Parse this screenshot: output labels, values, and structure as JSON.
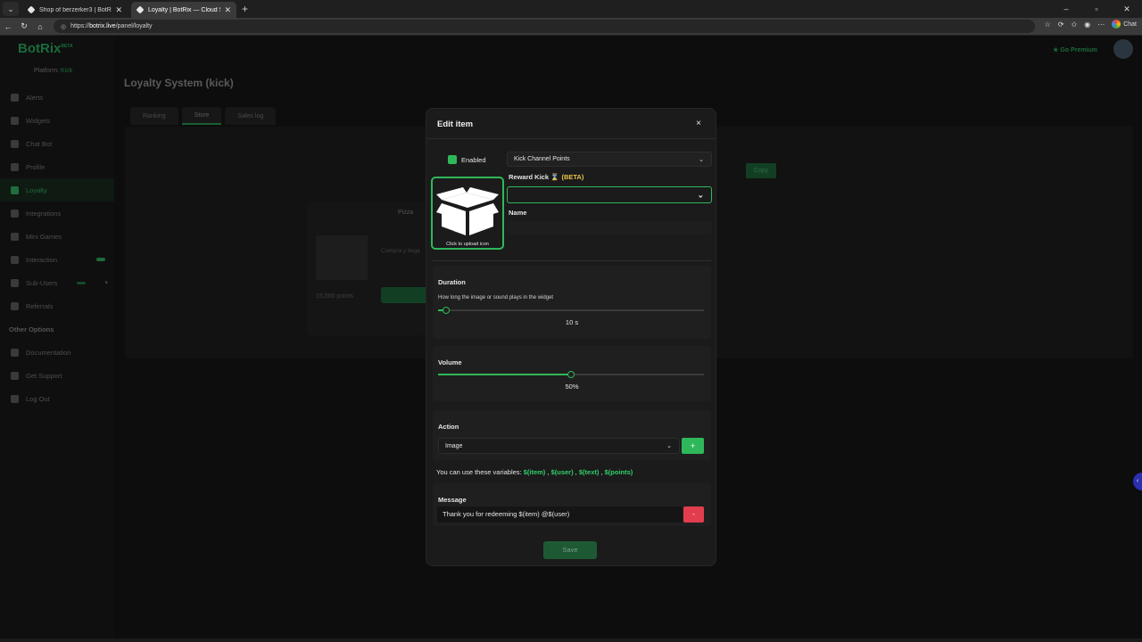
{
  "browser": {
    "tabs": [
      {
        "title": "Shop of berzerker3 | BotRix — Clo",
        "active": false
      },
      {
        "title": "Loyalty | BotRix — Cloud Streamin",
        "active": true
      }
    ],
    "url_prefix": "https://",
    "url_host": "botrix.live",
    "url_path": "/panel/loyalty",
    "chat_label": "Chat",
    "window_controls": [
      "–",
      "▫",
      "✕"
    ]
  },
  "app": {
    "logo": "BotRix",
    "logo_beta": "BETA",
    "platform_label": "Platform:",
    "platform_value": "Kick",
    "go_premium": "Go Premium",
    "nav": [
      {
        "label": "Alerts",
        "icon": "bell-icon"
      },
      {
        "label": "Widgets",
        "icon": "widget-icon"
      },
      {
        "label": "Chat Bot",
        "icon": "bot-icon"
      },
      {
        "label": "Profile",
        "icon": "profile-icon"
      },
      {
        "label": "Loyalty",
        "icon": "trophy-icon",
        "active": true
      },
      {
        "label": "Integrations",
        "icon": "plug-icon"
      },
      {
        "label": "Mini Games",
        "icon": "gamepad-icon"
      },
      {
        "label": "Interaction",
        "icon": "music-icon"
      },
      {
        "label": "Sub-Users",
        "icon": "users-icon"
      },
      {
        "label": "Referrals",
        "icon": "referral-icon"
      }
    ],
    "other_options_heading": "Other Options",
    "other_nav": [
      {
        "label": "Documentation",
        "icon": "doc-icon"
      },
      {
        "label": "Get Support",
        "icon": "support-icon"
      },
      {
        "label": "Log Out",
        "icon": "logout-icon"
      }
    ],
    "page_title": "Loyalty System (kick)",
    "page_tabs": [
      "Ranking",
      "Store",
      "Sales log"
    ],
    "active_tab": "Store",
    "shop_item": {
      "name": "Pizza",
      "description": "Compra y llega",
      "points": "15,000 points"
    },
    "copy_label": "Copy"
  },
  "modal": {
    "title": "Edit item",
    "close_glyph": "×",
    "enabled_label": "Enabled",
    "enabled": true,
    "points_source": "Kick Channel Points",
    "reward_label": "Reward Kick",
    "reward_beta": "(BETA)",
    "reward_value": "",
    "upload_hint": "Click to upload icon",
    "name_label": "Name",
    "name_value": "",
    "duration": {
      "label": "Duration",
      "description": "How long the image or sound plays in the widget",
      "value_text": "10 s",
      "fraction": 0.03
    },
    "volume": {
      "label": "Volume",
      "value_text": "50%",
      "fraction": 0.5
    },
    "action": {
      "label": "Action",
      "selected": "Image",
      "add_glyph": "+"
    },
    "variables_prefix": "You can use these variables:",
    "variables": [
      "$(item)",
      "$(user)",
      "$(text)",
      "$(points)"
    ],
    "message": {
      "label": "Message",
      "value": "Thank you for redeeming $(item) @$(user)",
      "remove_glyph": "-"
    },
    "save_label": "Save",
    "accent": "#2fb85a",
    "danger": "#e23d4f"
  }
}
